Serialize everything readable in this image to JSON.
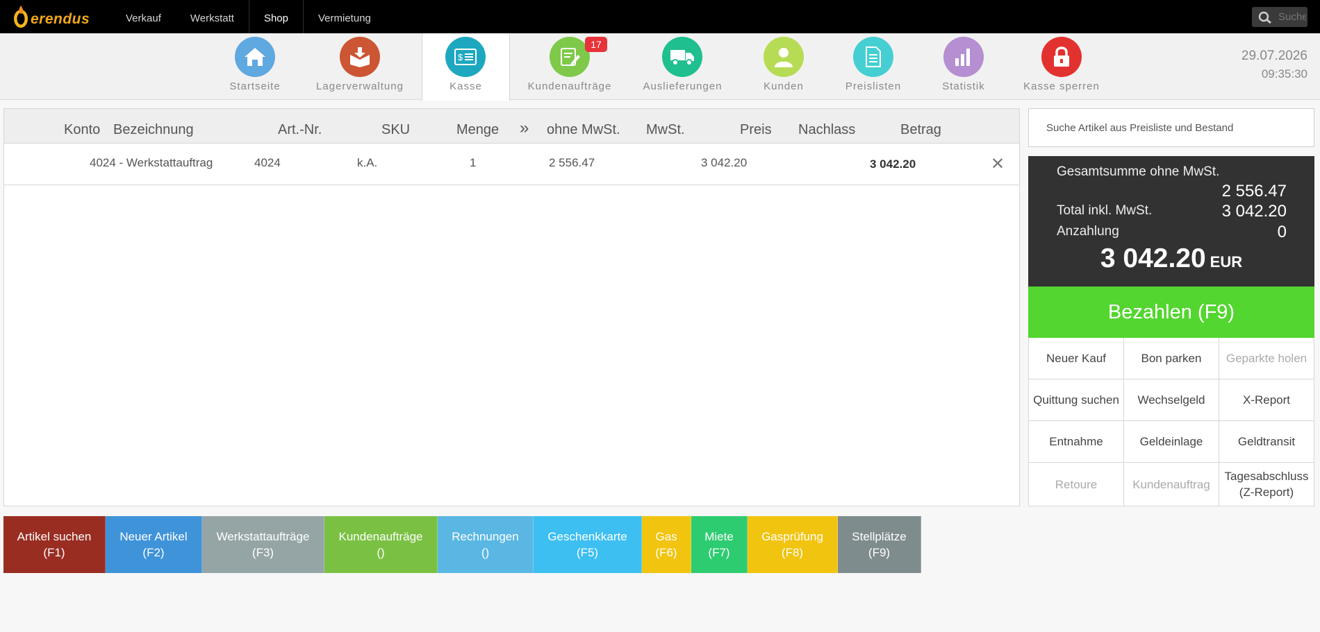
{
  "app": {
    "logo_text": "erendus"
  },
  "topnav": [
    {
      "label": "Verkauf",
      "active": false
    },
    {
      "label": "Werkstatt",
      "active": false
    },
    {
      "label": "Shop",
      "active": true
    },
    {
      "label": "Vermietung",
      "active": false
    }
  ],
  "header_search": {
    "placeholder": "Suche"
  },
  "modules": [
    {
      "label": "Startseite",
      "icon": "home-icon",
      "color": "#5fa8e0"
    },
    {
      "label": "Lagerverwaltung",
      "icon": "warehouse-box-icon",
      "color": "#cc5533"
    },
    {
      "label": "Kasse",
      "icon": "cash-register-icon",
      "color": "#1ea8c0",
      "active": true
    },
    {
      "label": "Kundenaufträge",
      "icon": "order-edit-icon",
      "color": "#7ec94a",
      "badge": "17"
    },
    {
      "label": "Auslieferungen",
      "icon": "delivery-truck-icon",
      "color": "#1fbf8f"
    },
    {
      "label": "Kunden",
      "icon": "customer-icon",
      "color": "#b6dc55"
    },
    {
      "label": "Preislisten",
      "icon": "document-icon",
      "color": "#45cfd3"
    },
    {
      "label": "Statistik",
      "icon": "bar-chart-icon",
      "color": "#b58fd1"
    },
    {
      "label": "Kasse sperren",
      "icon": "lock-icon",
      "color": "#e2322f"
    }
  ],
  "datetime": {
    "date": "29.07.2026",
    "time": "09:35:30"
  },
  "table": {
    "columns": [
      "Konto",
      "Bezeichnung",
      "Art.-Nr.",
      "SKU",
      "Menge",
      "»",
      "ohne MwSt.",
      "MwSt.",
      "Preis",
      "Nachlass",
      "Betrag"
    ],
    "rows": [
      {
        "bezeichnung": "4024 - Werkstattauftrag",
        "art_nr": "4024",
        "sku": "k.A.",
        "menge": "1",
        "ohne_mwst": "2 556.47",
        "preis": "3 042.20",
        "betrag": "3 042.20",
        "remove": "✕"
      }
    ]
  },
  "article_search": {
    "placeholder": "Suche Artikel aus Preisliste und Bestand"
  },
  "totals": {
    "net_label": "Gesamtsumme ohne MwSt.",
    "net_value": "2 556.47",
    "gross_label": "Total inkl. MwSt.",
    "gross_value": "3 042.20",
    "deposit_label": "Anzahlung",
    "deposit_value": "0",
    "grand_value": "3 042.20",
    "currency": "EUR"
  },
  "pay_button": "Bezahlen (F9)",
  "actions": [
    {
      "label": "Neuer Kauf",
      "enabled": true
    },
    {
      "label": "Bon parken",
      "enabled": true
    },
    {
      "label": "Geparkte holen",
      "enabled": false
    },
    {
      "label": "Quittung suchen",
      "enabled": true
    },
    {
      "label": "Wechselgeld",
      "enabled": true
    },
    {
      "label": "X-Report",
      "enabled": true
    },
    {
      "label": "Entnahme",
      "enabled": true
    },
    {
      "label": "Geldeinlage",
      "enabled": true
    },
    {
      "label": "Geldtransit",
      "enabled": true
    },
    {
      "label": "Retoure",
      "enabled": false
    },
    {
      "label": "Kundenauftrag",
      "enabled": false
    },
    {
      "label": "Tagesabschluss",
      "label2": "(Z-Report)",
      "enabled": true
    }
  ],
  "fkeys": [
    {
      "label": "Artikel suchen",
      "key": "(F1)",
      "color": "#992d22"
    },
    {
      "label": "Neuer Artikel",
      "key": "(F2)",
      "color": "#3f93d9"
    },
    {
      "label": "Werkstattaufträge",
      "key": "(F3)",
      "color": "#95a5a6"
    },
    {
      "label": "Kundenaufträge",
      "key": "()",
      "color": "#7ac143"
    },
    {
      "label": "Rechnungen",
      "key": "()",
      "color": "#5ab7e4"
    },
    {
      "label": "Geschenkkarte",
      "key": "(F5)",
      "color": "#3dbff2"
    },
    {
      "label": "Gas",
      "key": "(F6)",
      "color": "#f1c40f"
    },
    {
      "label": "Miete",
      "key": "(F7)",
      "color": "#2ecc71"
    },
    {
      "label": "Gasprüfung",
      "key": "(F8)",
      "color": "#f1c40f"
    },
    {
      "label": "Stellplätze",
      "key": "(F9)",
      "color": "#7f8c8d"
    }
  ]
}
